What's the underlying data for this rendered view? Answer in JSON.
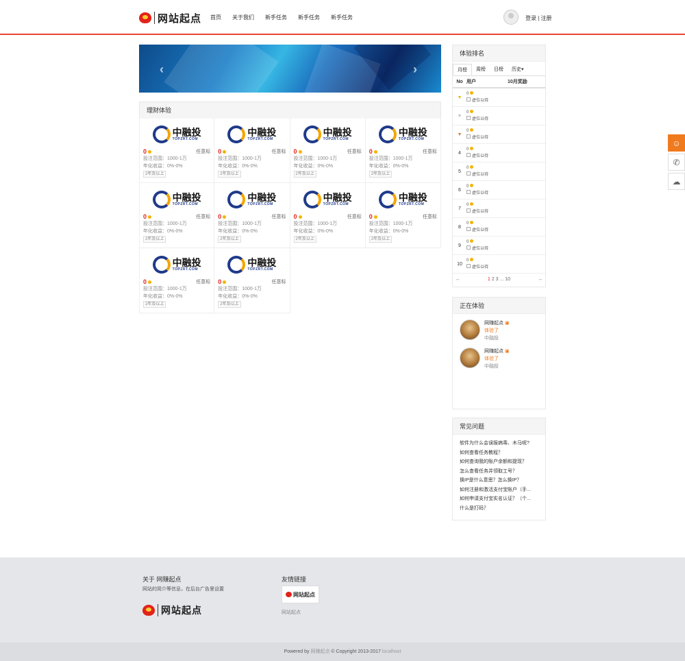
{
  "header": {
    "logo_text": "网站起点",
    "nav": [
      "首页",
      "关于我们",
      "新手任务",
      "新手任务",
      "新手任务"
    ],
    "login": "登录 | 注册"
  },
  "banner": {
    "prev": "‹",
    "next": "›"
  },
  "section": {
    "title": "理财体验"
  },
  "products": [
    {
      "brand": "中融投",
      "site": "TOPZRT.COM",
      "num": "0",
      "type": "任意标",
      "range": "投注范围：1000-1万",
      "yield": "年化收益：0%-0%",
      "tag": "2年及以上"
    },
    {
      "brand": "中融投",
      "site": "TOPZRT.COM",
      "num": "0",
      "type": "任意标",
      "range": "投注范围：1000-1万",
      "yield": "年化收益：0%-0%",
      "tag": "2年及以上"
    },
    {
      "brand": "中融投",
      "site": "TOPZRT.COM",
      "num": "0",
      "type": "任意标",
      "range": "投注范围：1000-1万",
      "yield": "年化收益：0%-0%",
      "tag": "2年及以上"
    },
    {
      "brand": "中融投",
      "site": "TOPZRT.COM",
      "num": "0",
      "type": "任意标",
      "range": "投注范围：1000-1万",
      "yield": "年化收益：0%-0%",
      "tag": "2年及以上"
    },
    {
      "brand": "中融投",
      "site": "TOPZRT.COM",
      "num": "0",
      "type": "任意标",
      "range": "投注范围：1000-1万",
      "yield": "年化收益：0%-0%",
      "tag": "2年及以上"
    },
    {
      "brand": "中融投",
      "site": "TOPZRT.COM",
      "num": "0",
      "type": "任意标",
      "range": "投注范围：1000-1万",
      "yield": "年化收益：0%-0%",
      "tag": "2年及以上"
    },
    {
      "brand": "中融投",
      "site": "TOPZRT.COM",
      "num": "0",
      "type": "任意标",
      "range": "投注范围：1000-1万",
      "yield": "年化收益：0%-0%",
      "tag": "2年及以上"
    },
    {
      "brand": "中融投",
      "site": "TOPZRT.COM",
      "num": "0",
      "type": "任意标",
      "range": "投注范围：1000-1万",
      "yield": "年化收益：0%-0%",
      "tag": "2年及以上"
    },
    {
      "brand": "中融投",
      "site": "TOPZRT.COM",
      "num": "0",
      "type": "任意标",
      "range": "投注范围：1000-1万",
      "yield": "年化收益：0%-0%",
      "tag": "2年及以上"
    },
    {
      "brand": "中融投",
      "site": "TOPZRT.COM",
      "num": "0",
      "type": "任意标",
      "range": "投注范围：1000-1万",
      "yield": "年化收益：0%-0%",
      "tag": "2年及以上"
    }
  ],
  "ranking": {
    "title": "体验排名",
    "tabs": [
      "月榜",
      "周榜",
      "日榜",
      "历史▾"
    ],
    "col_no": "No",
    "col_user": "用户",
    "col_prize": "10月奖励",
    "rows": [
      {
        "no": "",
        "score": "0",
        "name": "虚位以待"
      },
      {
        "no": "",
        "score": "0",
        "name": "虚位以待"
      },
      {
        "no": "",
        "score": "0",
        "name": "虚位以待"
      },
      {
        "no": "4",
        "score": "0",
        "name": "虚位以待"
      },
      {
        "no": "5",
        "score": "0",
        "name": "虚位以待"
      },
      {
        "no": "6",
        "score": "0",
        "name": "虚位以待"
      },
      {
        "no": "7",
        "score": "0",
        "name": "虚位以待"
      },
      {
        "no": "8",
        "score": "0",
        "name": "虚位以待"
      },
      {
        "no": "9",
        "score": "0",
        "name": "虚位以待"
      },
      {
        "no": "10",
        "score": "0",
        "name": "虚位以待"
      }
    ],
    "pager": {
      "prev": "←",
      "pages": [
        "1",
        "2",
        "3",
        "...",
        "10"
      ],
      "next": "→"
    }
  },
  "experiencing": {
    "title": "正在体验",
    "items": [
      {
        "user": "网赚起点",
        "action": "体验了",
        "product": "中融投"
      },
      {
        "user": "网赚起点",
        "action": "体验了",
        "product": "中融投"
      }
    ]
  },
  "faq": {
    "title": "常见问题",
    "items": [
      "软件为什么会误报病毒、木马呢?",
      "如何查看任务教程？",
      "如何查询我的账户余额和提现？",
      "怎么查看任务并领取工号？",
      "换IP是什么意思？怎么换IP？",
      "如何注册和激活支付宝账户（手...",
      "如何申请支付宝实名认证？（个...",
      "什么是打码？"
    ]
  },
  "footer": {
    "about_title": "关于 网赚起点",
    "about_text": "网站的简介等信息，在后台广告里设置",
    "links_title": "友情链接",
    "link_name": "网站起点",
    "logo_text": "网站起点",
    "copyright_pre": "Powered by ",
    "copyright_site": "网赚起点",
    "copyright_mid": " © Copyright 2013-2017 ",
    "copyright_host": "localhost"
  },
  "colors": {
    "accent": "#e84236",
    "brand_red": "#e2231a",
    "orange": "#f07a1e"
  }
}
